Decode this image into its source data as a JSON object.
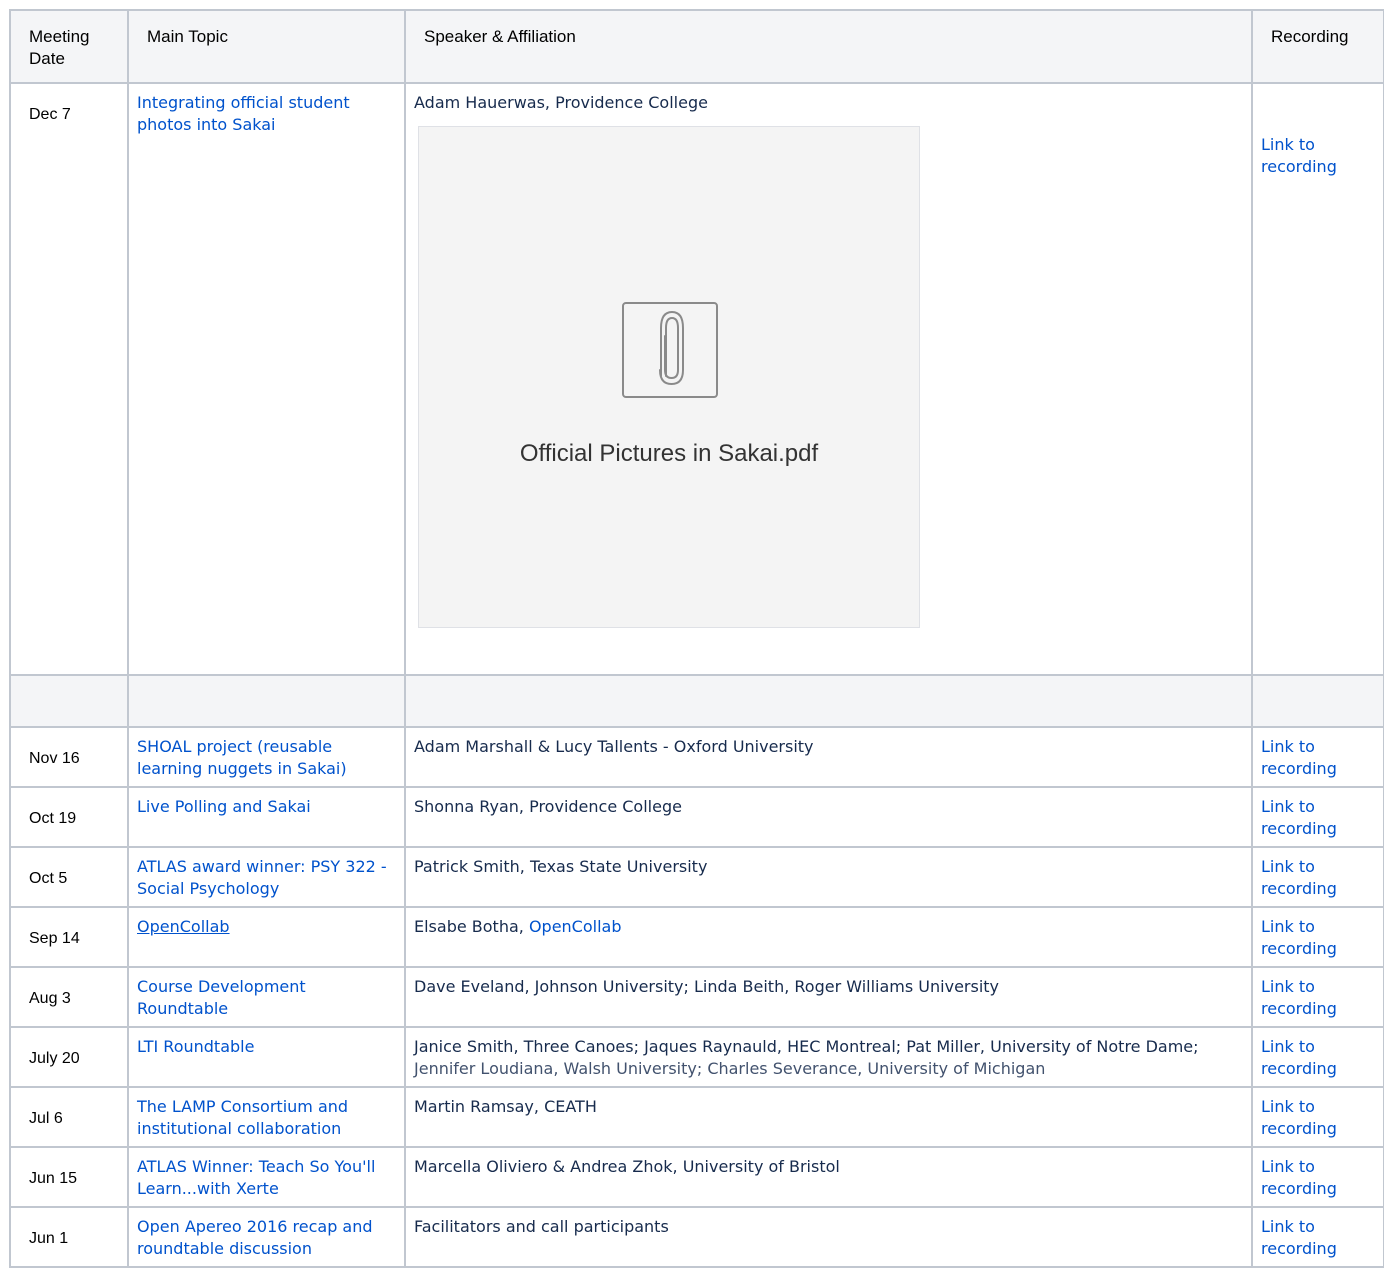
{
  "table": {
    "headers": {
      "date": "Meeting Date",
      "topic": "Main Topic",
      "speaker": "Speaker & Affiliation",
      "recording": "Recording"
    },
    "first_row": {
      "date": "Dec 7",
      "topic": "Integrating official student photos into Sakai",
      "speaker": "Adam Hauerwas, Providence College",
      "attachment": {
        "filename": "Official Pictures in Sakai.pdf",
        "icon": "paperclip-icon"
      },
      "recording": "Link to recording"
    },
    "rows": [
      {
        "date": "Nov 16",
        "topic": "SHOAL project (reusable learning nuggets in Sakai)",
        "speaker": "Adam Marshall & Lucy Tallents - Oxford University",
        "recording": "Link to recording"
      },
      {
        "date": "Oct 19",
        "topic": "Live Polling and Sakai",
        "speaker": "Shonna Ryan, Providence College",
        "recording": "Link to recording"
      },
      {
        "date": "Oct 5",
        "topic": "ATLAS award winner: PSY 322 - Social Psychology",
        "speaker": "Patrick Smith, Texas State University",
        "recording": "Link to recording"
      },
      {
        "date": "Sep 14",
        "topic": "OpenCollab",
        "speaker_prefix": "Elsabe Botha, ",
        "speaker_link": "OpenCollab",
        "recording": "Link to recording"
      },
      {
        "date": "Aug 3",
        "topic": "Course Development Roundtable",
        "speaker": "Dave Eveland, Johnson University; Linda Beith, Roger Williams University",
        "recording": "Link to recording"
      },
      {
        "date": "July 20",
        "topic": "LTI Roundtable",
        "speaker_part1": "Janice Smith, Three Canoes; Jaques Raynauld, HEC Montreal; Pat Miller, University of Notre Dame; ",
        "speaker_part2": "Jennifer Loudiana, Walsh University; Charles Severance, University of Michigan",
        "recording": "Link to recording"
      },
      {
        "date": "Jul 6",
        "topic": "The LAMP Consortium and institutional collaboration",
        "speaker": "Martin Ramsay, CEATH",
        "recording": "Link to recording"
      },
      {
        "date": "Jun 15",
        "topic": "ATLAS Winner: Teach So You'll Learn...with Xerte",
        "speaker": "Marcella Oliviero & Andrea Zhok, University of Bristol",
        "recording": "Link to recording"
      },
      {
        "date": "Jun 1",
        "topic": "Open Apereo 2016 recap and roundtable discussion",
        "speaker": "Facilitators and call participants",
        "recording": "Link to recording"
      }
    ],
    "colors": {
      "link": "#0052cc",
      "border": "#c1c7d0",
      "header_bg": "#f4f5f7",
      "text": "#172b4d"
    }
  }
}
